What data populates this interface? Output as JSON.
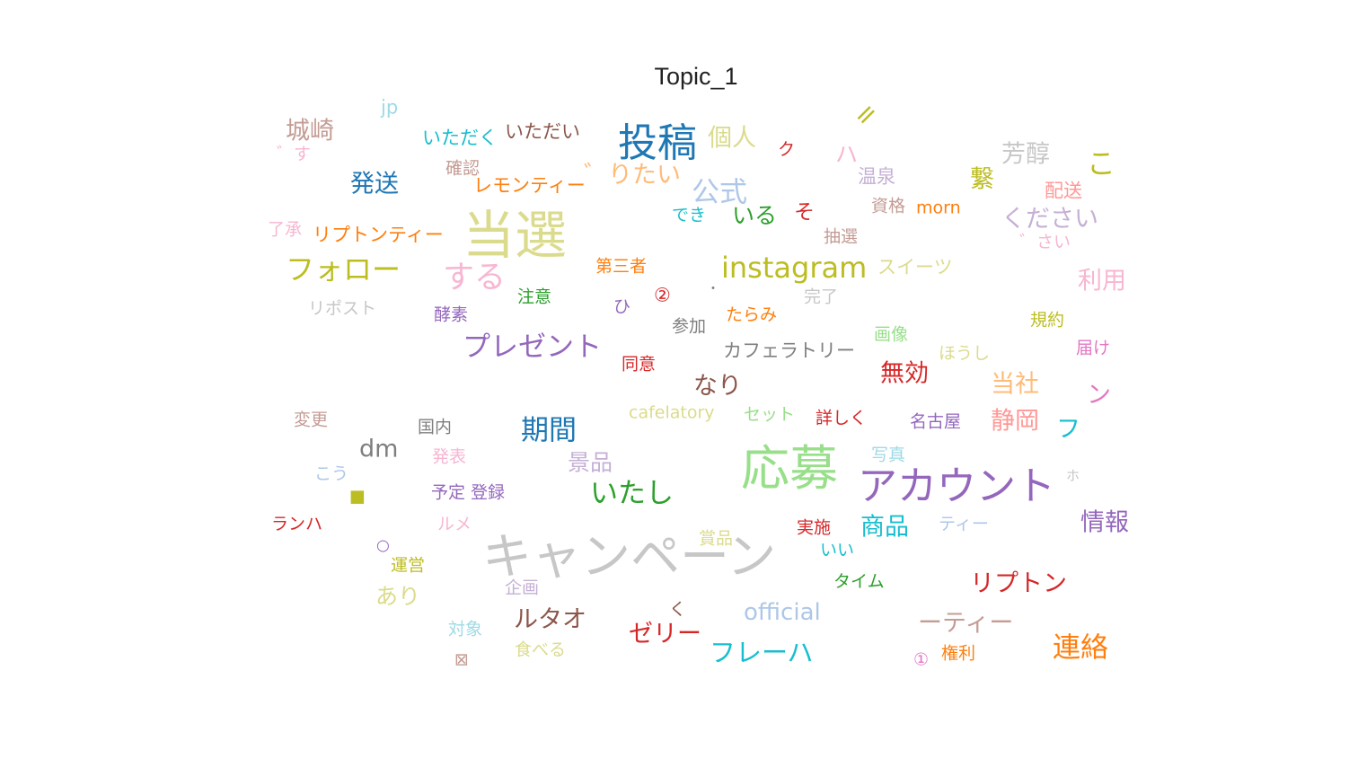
{
  "chart_data": {
    "type": "wordcloud",
    "title": "Topic_1",
    "words": [
      {
        "text": "jp",
        "color": "#9edae5"
      },
      {
        "text": "城崎",
        "color": "#c49c94"
      },
      {
        "text": "゛す",
        "color": "#f7b6d2"
      },
      {
        "text": "いただく",
        "color": "#17becf"
      },
      {
        "text": "いただい",
        "color": "#8c564b"
      },
      {
        "text": "投稿",
        "color": "#1f77b4"
      },
      {
        "text": "個人",
        "color": "#dbdb8d"
      },
      {
        "text": "ク",
        "color": "#d62728"
      },
      {
        "text": "ハ",
        "color": "#f7b6d2"
      },
      {
        "text": "=",
        "color": "#bcbd22"
      },
      {
        "text": "芳醇",
        "color": "#c7c7c7"
      },
      {
        "text": "こ",
        "color": "#bcbd22"
      },
      {
        "text": "確認",
        "color": "#c49c94"
      },
      {
        "text": "発送",
        "color": "#1f77b4"
      },
      {
        "text": "レモンティー",
        "color": "#ff7f0e"
      },
      {
        "text": "゛りたい",
        "color": "#ffbb78"
      },
      {
        "text": "公式",
        "color": "#aec7e8"
      },
      {
        "text": "温泉",
        "color": "#c5b0d5"
      },
      {
        "text": "繋",
        "color": "#bcbd22"
      },
      {
        "text": "配送",
        "color": "#ff9896"
      },
      {
        "text": "でき",
        "color": "#17becf"
      },
      {
        "text": "いる",
        "color": "#2ca02c"
      },
      {
        "text": "そ",
        "color": "#d62728"
      },
      {
        "text": "資格",
        "color": "#c49c94"
      },
      {
        "text": "morn",
        "color": "#ff7f0e"
      },
      {
        "text": "ください",
        "color": "#c5b0d5"
      },
      {
        "text": "゛さい",
        "color": "#f7b6d2"
      },
      {
        "text": "抽選",
        "color": "#c49c94"
      },
      {
        "text": "了承",
        "color": "#f7b6d2"
      },
      {
        "text": "リプトンティー",
        "color": "#ff7f0e"
      },
      {
        "text": "当選",
        "color": "#dbdb8d"
      },
      {
        "text": "第三者",
        "color": "#ff7f0e"
      },
      {
        "text": "フォロー",
        "color": "#bcbd22"
      },
      {
        "text": "する",
        "color": "#f7b6d2"
      },
      {
        "text": "instagram",
        "color": "#bcbd22"
      },
      {
        "text": "スイーツ",
        "color": "#dbdb8d"
      },
      {
        "text": "利用",
        "color": "#f7b6d2"
      },
      {
        "text": "注意",
        "color": "#2ca02c"
      },
      {
        "text": "②",
        "color": "#d62728"
      },
      {
        "text": "・",
        "color": "#7f7f7f"
      },
      {
        "text": "完了",
        "color": "#c7c7c7"
      },
      {
        "text": "リポスト",
        "color": "#c7c7c7"
      },
      {
        "text": "酵素",
        "color": "#9467bd"
      },
      {
        "text": "ひ",
        "color": "#9467bd"
      },
      {
        "text": "たらみ",
        "color": "#ff7f0e"
      },
      {
        "text": "規約",
        "color": "#bcbd22"
      },
      {
        "text": "参加",
        "color": "#7f7f7f"
      },
      {
        "text": "画像",
        "color": "#98df8a"
      },
      {
        "text": "プレゼント",
        "color": "#9467bd"
      },
      {
        "text": "カフェラトリー",
        "color": "#7f7f7f"
      },
      {
        "text": "ほうし",
        "color": "#dbdb8d"
      },
      {
        "text": "届け",
        "color": "#e377c2"
      },
      {
        "text": "同意",
        "color": "#d62728"
      },
      {
        "text": "無効",
        "color": "#d62728"
      },
      {
        "text": "なり",
        "color": "#8c564b"
      },
      {
        "text": "当社",
        "color": "#ffbb78"
      },
      {
        "text": "ン",
        "color": "#e377c2"
      },
      {
        "text": "変更",
        "color": "#c49c94"
      },
      {
        "text": "国内",
        "color": "#7f7f7f"
      },
      {
        "text": "期間",
        "color": "#1f77b4"
      },
      {
        "text": "cafelatory",
        "color": "#dbdb8d"
      },
      {
        "text": "セット",
        "color": "#98df8a"
      },
      {
        "text": "詳しく",
        "color": "#d62728"
      },
      {
        "text": "名古屋",
        "color": "#9467bd"
      },
      {
        "text": "静岡",
        "color": "#ff9896"
      },
      {
        "text": "フ",
        "color": "#17becf"
      },
      {
        "text": "dm",
        "color": "#7f7f7f"
      },
      {
        "text": "発表",
        "color": "#f7b6d2"
      },
      {
        "text": "景品",
        "color": "#c5b0d5"
      },
      {
        "text": "写真",
        "color": "#9edae5"
      },
      {
        "text": "応募",
        "color": "#98df8a"
      },
      {
        "text": "アカウント",
        "color": "#9467bd"
      },
      {
        "text": "ホ",
        "color": "#c7c7c7"
      },
      {
        "text": "こう",
        "color": "#aec7e8"
      },
      {
        "text": "■",
        "color": "#bcbd22"
      },
      {
        "text": "予定 登録",
        "color": "#9467bd"
      },
      {
        "text": "いたし",
        "color": "#2ca02c"
      },
      {
        "text": "ランハ",
        "color": "#d62728"
      },
      {
        "text": "ルメ",
        "color": "#f7b6d2"
      },
      {
        "text": "実施",
        "color": "#d62728"
      },
      {
        "text": "商品",
        "color": "#17becf"
      },
      {
        "text": "ティー",
        "color": "#aec7e8"
      },
      {
        "text": "情報",
        "color": "#9467bd"
      },
      {
        "text": "キャンペーン",
        "color": "#c7c7c7"
      },
      {
        "text": "賞品",
        "color": "#dbdb8d"
      },
      {
        "text": "○",
        "color": "#9467bd"
      },
      {
        "text": "運営",
        "color": "#bcbd22"
      },
      {
        "text": "いい",
        "color": "#17becf"
      },
      {
        "text": "企画",
        "color": "#c5b0d5"
      },
      {
        "text": "タイム",
        "color": "#2ca02c"
      },
      {
        "text": "リプトン",
        "color": "#d62728"
      },
      {
        "text": "あり",
        "color": "#dbdb8d"
      },
      {
        "text": "く",
        "color": "#8c564b"
      },
      {
        "text": "ルタオ",
        "color": "#8c564b"
      },
      {
        "text": "official",
        "color": "#aec7e8"
      },
      {
        "text": "ーティー",
        "color": "#c49c94"
      },
      {
        "text": "対象",
        "color": "#9edae5"
      },
      {
        "text": "ゼリー",
        "color": "#d62728"
      },
      {
        "text": "連絡",
        "color": "#ff7f0e"
      },
      {
        "text": "食べる",
        "color": "#dbdb8d"
      },
      {
        "text": "フレーハ",
        "color": "#17becf"
      },
      {
        "text": "①",
        "color": "#e377c2"
      },
      {
        "text": "権利",
        "color": "#ff7f0e"
      },
      {
        "text": "⊠",
        "color": "#c49c94"
      }
    ]
  }
}
